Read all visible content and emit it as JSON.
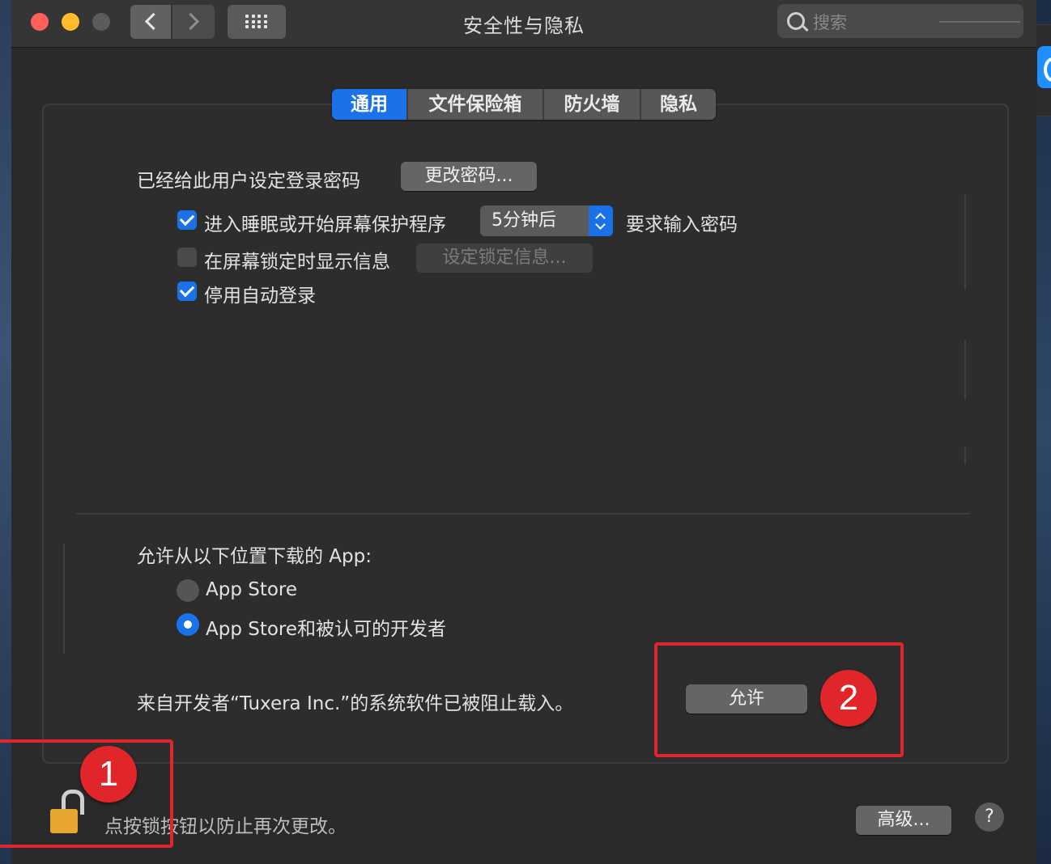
{
  "window": {
    "title": "安全性与隐私",
    "search_placeholder": "搜索"
  },
  "tabs": [
    {
      "label": "通用",
      "active": true
    },
    {
      "label": "文件保险箱",
      "active": false
    },
    {
      "label": "防火墙",
      "active": false
    },
    {
      "label": "隐私",
      "active": false
    }
  ],
  "general": {
    "login_password_text": "已经给此用户设定登录密码",
    "change_password_button": "更改密码...",
    "require_password_label": "进入睡眠或开始屏幕保护程序",
    "require_password_checked": true,
    "require_password_delay": "5分钟后",
    "require_password_suffix": "要求输入密码",
    "show_message_label": "在屏幕锁定时显示信息",
    "show_message_checked": false,
    "set_lock_message_button": "设定锁定信息...",
    "disable_auto_login_label": "停用自动登录",
    "disable_auto_login_checked": true
  },
  "downloads": {
    "heading": "允许从以下位置下载的 App:",
    "options": [
      {
        "label": "App Store",
        "selected": false
      },
      {
        "label": "App Store和被认可的开发者",
        "selected": true
      }
    ]
  },
  "blocked": {
    "message": "来自开发者“Tuxera Inc.”的系统软件已被阻止载入。",
    "allow_button": "允许"
  },
  "footer": {
    "lock_text": "点按锁按钮以防止再次更改。",
    "advanced_button": "高级...",
    "help_label": "?"
  },
  "annotations": {
    "badge_1": "1",
    "badge_2": "2"
  },
  "colors": {
    "accent": "#1b72e8",
    "annotation_red": "#e0252b",
    "lock": "#e6a630"
  },
  "icons": [
    "close-icon",
    "minimize-icon",
    "zoom-icon",
    "chevron-left-icon",
    "chevron-right-icon",
    "grid-icon",
    "search-icon",
    "checkmark-icon",
    "chevron-updown-icon",
    "lock-icon",
    "help-icon"
  ]
}
